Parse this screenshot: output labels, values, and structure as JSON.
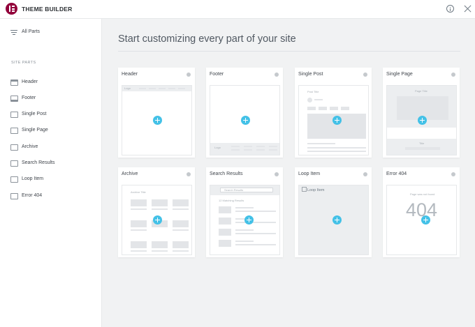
{
  "app": {
    "title": "THEME BUILDER"
  },
  "sidebar": {
    "all_parts": "All Parts",
    "section_label": "SITE PARTS",
    "items": [
      {
        "label": "Header"
      },
      {
        "label": "Footer"
      },
      {
        "label": "Single Post"
      },
      {
        "label": "Single Page"
      },
      {
        "label": "Archive"
      },
      {
        "label": "Search Results"
      },
      {
        "label": "Loop Item"
      },
      {
        "label": "Error 404"
      }
    ]
  },
  "main": {
    "heading": "Start customizing every part of your site",
    "cards": [
      {
        "title": "Header"
      },
      {
        "title": "Footer"
      },
      {
        "title": "Single Post"
      },
      {
        "title": "Single Page"
      },
      {
        "title": "Archive"
      },
      {
        "title": "Search Results"
      },
      {
        "title": "Loop Item"
      },
      {
        "title": "Error 404"
      }
    ],
    "thumb_text": {
      "header_logo": "Logo",
      "footer_logo": "Logo",
      "post_title": "Post Title",
      "page_title": "Page Title",
      "page_title_small": "Title",
      "archive_title": "Archive Title",
      "search_placeholder": "Search Results",
      "search_count": "12 Matching Results",
      "loop_alt": "Loop Item",
      "error_text": "Page was not found",
      "error_code": "404"
    }
  },
  "colors": {
    "accent": "#43c1e7",
    "brand": "#92003b"
  }
}
